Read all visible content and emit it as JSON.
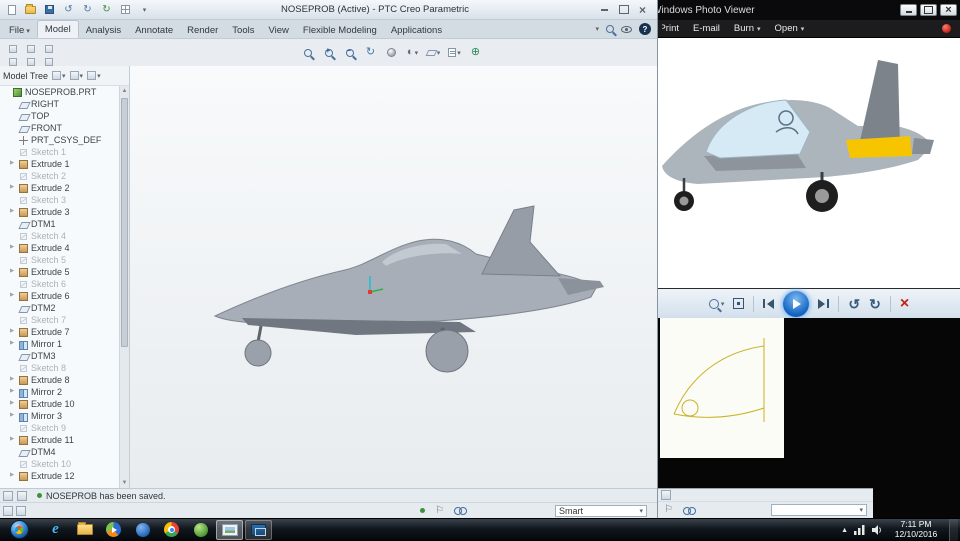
{
  "creo": {
    "title": "NOSEPROB (Active) - PTC Creo Parametric",
    "file_tab": "File",
    "quick_access": [
      "new",
      "open",
      "save",
      "undo",
      "redo",
      "regenerate",
      "windows",
      "customize"
    ],
    "tabs": [
      {
        "label": "Model",
        "selected": true
      },
      {
        "label": "Analysis"
      },
      {
        "label": "Annotate"
      },
      {
        "label": "Render"
      },
      {
        "label": "Tools"
      },
      {
        "label": "View"
      },
      {
        "label": "Flexible Modeling"
      },
      {
        "label": "Applications"
      }
    ],
    "graphics_toolbar": [
      "refit",
      "zoom-in",
      "zoom-out",
      "repaint",
      "shade",
      "display-style",
      "datum-display",
      "annotation-display",
      "spin-center"
    ],
    "model_tree": {
      "title": "Model Tree",
      "items": [
        {
          "label": "NOSEPROB.PRT",
          "type": "part",
          "root": true
        },
        {
          "label": "RIGHT",
          "type": "plane"
        },
        {
          "label": "TOP",
          "type": "plane"
        },
        {
          "label": "FRONT",
          "type": "plane"
        },
        {
          "label": "PRT_CSYS_DEF",
          "type": "csys"
        },
        {
          "label": "Sketch 1",
          "type": "sketch",
          "dim": true
        },
        {
          "label": "Extrude 1",
          "type": "extrude",
          "expand": true
        },
        {
          "label": "Sketch 2",
          "type": "sketch",
          "dim": true
        },
        {
          "label": "Extrude 2",
          "type": "extrude",
          "expand": true
        },
        {
          "label": "Sketch 3",
          "type": "sketch",
          "dim": true
        },
        {
          "label": "Extrude 3",
          "type": "extrude",
          "expand": true
        },
        {
          "label": "DTM1",
          "type": "plane"
        },
        {
          "label": "Sketch 4",
          "type": "sketch",
          "dim": true
        },
        {
          "label": "Extrude 4",
          "type": "extrude",
          "expand": true
        },
        {
          "label": "Sketch 5",
          "type": "sketch",
          "dim": true
        },
        {
          "label": "Extrude 5",
          "type": "extrude",
          "expand": true
        },
        {
          "label": "Sketch 6",
          "type": "sketch",
          "dim": true
        },
        {
          "label": "Extrude 6",
          "type": "extrude",
          "expand": true
        },
        {
          "label": "DTM2",
          "type": "plane"
        },
        {
          "label": "Sketch 7",
          "type": "sketch",
          "dim": true
        },
        {
          "label": "Extrude 7",
          "type": "extrude",
          "expand": true
        },
        {
          "label": "Mirror 1",
          "type": "mirror",
          "expand": true
        },
        {
          "label": "DTM3",
          "type": "plane"
        },
        {
          "label": "Sketch 8",
          "type": "sketch",
          "dim": true
        },
        {
          "label": "Extrude 8",
          "type": "extrude",
          "expand": true
        },
        {
          "label": "Mirror 2",
          "type": "mirror",
          "expand": true
        },
        {
          "label": "Extrude 10",
          "type": "extrude",
          "expand": true
        },
        {
          "label": "Mirror 3",
          "type": "mirror",
          "expand": true
        },
        {
          "label": "Sketch 9",
          "type": "sketch",
          "dim": true
        },
        {
          "label": "Extrude 11",
          "type": "extrude",
          "expand": true
        },
        {
          "label": "DTM4",
          "type": "plane"
        },
        {
          "label": "Sketch 10",
          "type": "sketch",
          "dim": true
        },
        {
          "label": "Extrude 12",
          "type": "extrude",
          "expand": true
        }
      ]
    },
    "message": "NOSEPROB has been saved.",
    "selection_filter": "Smart"
  },
  "photo_viewer": {
    "title": "Windows Photo Viewer",
    "menu": [
      {
        "label": "Print",
        "caret": true,
        "clip": true
      },
      {
        "label": "E-mail"
      },
      {
        "label": "Burn",
        "caret": true
      },
      {
        "label": "Open",
        "caret": true
      }
    ],
    "controls": [
      "zoom",
      "actual-size",
      "previous",
      "play",
      "next",
      "rotate-ccw",
      "rotate-cw",
      "delete"
    ]
  },
  "black_window": {
    "filter_value": ""
  },
  "taskbar": {
    "icons": [
      {
        "name": "internet-explorer"
      },
      {
        "name": "file-explorer"
      },
      {
        "name": "media-player"
      },
      {
        "name": "messenger"
      },
      {
        "name": "chrome"
      },
      {
        "name": "webex"
      },
      {
        "name": "photo-viewer",
        "pressed": true
      },
      {
        "name": "creo",
        "active": true
      }
    ],
    "time": "7:11 PM",
    "date": "12/10/2016"
  }
}
